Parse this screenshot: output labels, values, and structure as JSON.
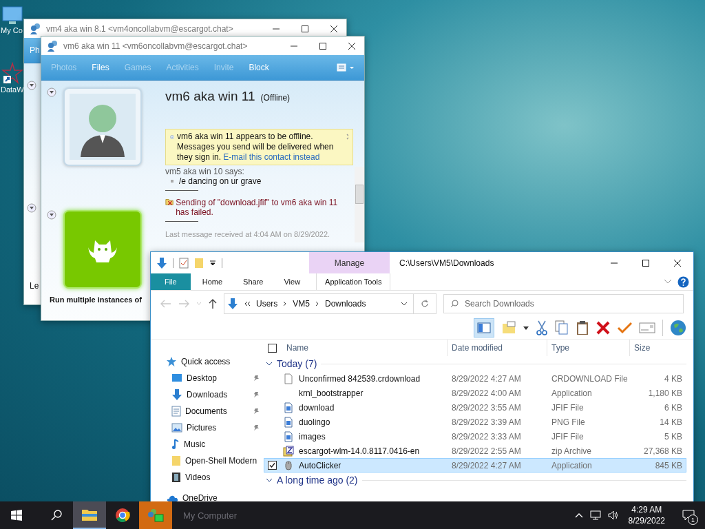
{
  "desktop_icons": [
    {
      "label": "My Co"
    },
    {
      "label": "DataW"
    }
  ],
  "messenger_back": {
    "title": "vm4 aka win 8.1 <vm4oncollabvm@escargot.chat>",
    "tab_fragment": "Ph",
    "footer_fragment": "Le"
  },
  "messenger": {
    "title": "vm6 aka win 11 <vm6oncollabvm@escargot.chat>",
    "tabs": [
      {
        "label": "Photos",
        "disabled": true
      },
      {
        "label": "Files",
        "disabled": false
      },
      {
        "label": "Games",
        "disabled": true
      },
      {
        "label": "Activities",
        "disabled": true
      },
      {
        "label": "Invite",
        "disabled": true
      },
      {
        "label": "Block",
        "disabled": false
      }
    ],
    "contact_name": "vm6 aka win 11",
    "status": "(Offline)",
    "notice": {
      "text": "vm6 aka win 11 appears to be offline. Messages you send will be delivered when they sign in.",
      "link": "E-mail this contact instead"
    },
    "messages": [
      {
        "kind": "said",
        "sender": "vm5 aka win 10 says:",
        "text": "/e dancing on ur grave"
      },
      {
        "kind": "error",
        "text": "Sending of \"download.jfif\" to vm6 aka win 11 has failed."
      }
    ],
    "last_message": "Last message received at 4:04 AM on 8/29/2022.",
    "caption": "Run multiple instances of"
  },
  "explorer": {
    "title": "C:\\Users\\VM5\\Downloads",
    "context_tab": "Manage",
    "ribbon_tabs": [
      {
        "label": "File",
        "kind": "file",
        "selected": false
      },
      {
        "label": "Home",
        "kind": "plain",
        "selected": false
      },
      {
        "label": "Share",
        "kind": "plain",
        "selected": false
      },
      {
        "label": "View",
        "kind": "plain",
        "selected": false
      },
      {
        "label": "Application Tools",
        "kind": "context",
        "selected": false
      }
    ],
    "breadcrumb": [
      "Users",
      "VM5",
      "Downloads"
    ],
    "search": {
      "placeholder": "Search Downloads"
    },
    "nav": [
      {
        "label": "Quick access",
        "children": [
          {
            "label": "Desktop",
            "pinned": true
          },
          {
            "label": "Downloads",
            "pinned": true
          },
          {
            "label": "Documents",
            "pinned": true
          },
          {
            "label": "Pictures",
            "pinned": true
          },
          {
            "label": "Music",
            "pinned": false
          },
          {
            "label": "Open-Shell Modern",
            "pinned": false
          },
          {
            "label": "Videos",
            "pinned": false
          }
        ]
      },
      {
        "label": "OneDrive"
      }
    ],
    "columns": [
      "Name",
      "Date modified",
      "Type",
      "Size"
    ],
    "select_all_checked": false,
    "groups": [
      {
        "label": "Today (7)",
        "expanded": true,
        "rows": [
          {
            "name": "Unconfirmed 842539.crdownload",
            "date": "8/29/2022 4:27 AM",
            "type": "CRDOWNLOAD File",
            "size": "4 KB",
            "kind": "blank",
            "selected": false,
            "checked": false
          },
          {
            "name": "krnl_bootstrapper",
            "date": "8/29/2022 4:00 AM",
            "type": "Application",
            "size": "1,180 KB",
            "kind": "none",
            "selected": false,
            "checked": false
          },
          {
            "name": "download",
            "date": "8/29/2022 3:55 AM",
            "type": "JFIF File",
            "size": "6 KB",
            "kind": "image",
            "selected": false,
            "checked": false
          },
          {
            "name": "duolingo",
            "date": "8/29/2022 3:39 AM",
            "type": "PNG File",
            "size": "14 KB",
            "kind": "image",
            "selected": false,
            "checked": false
          },
          {
            "name": "images",
            "date": "8/29/2022 3:33 AM",
            "type": "JFIF File",
            "size": "5 KB",
            "kind": "image",
            "selected": false,
            "checked": false
          },
          {
            "name": "escargot-wlm-14.0.8117.0416-en",
            "date": "8/29/2022 2:55 AM",
            "type": "zip Archive",
            "size": "27,368 KB",
            "kind": "zip",
            "selected": false,
            "checked": false
          },
          {
            "name": "AutoClicker",
            "date": "8/29/2022 4:27 AM",
            "type": "Application",
            "size": "845 KB",
            "kind": "app",
            "selected": true,
            "checked": true
          }
        ]
      },
      {
        "label": "A long time ago (2)",
        "expanded": true
      }
    ]
  },
  "taskbar": {
    "apps": [
      {
        "selected": true,
        "flashing": false
      },
      {
        "selected": false,
        "flashing": false
      },
      {
        "selected": false,
        "flashing": true
      }
    ],
    "preview_label": "My Computer",
    "time": "4:29 AM",
    "date": "8/29/2022",
    "notification_count": "1"
  }
}
